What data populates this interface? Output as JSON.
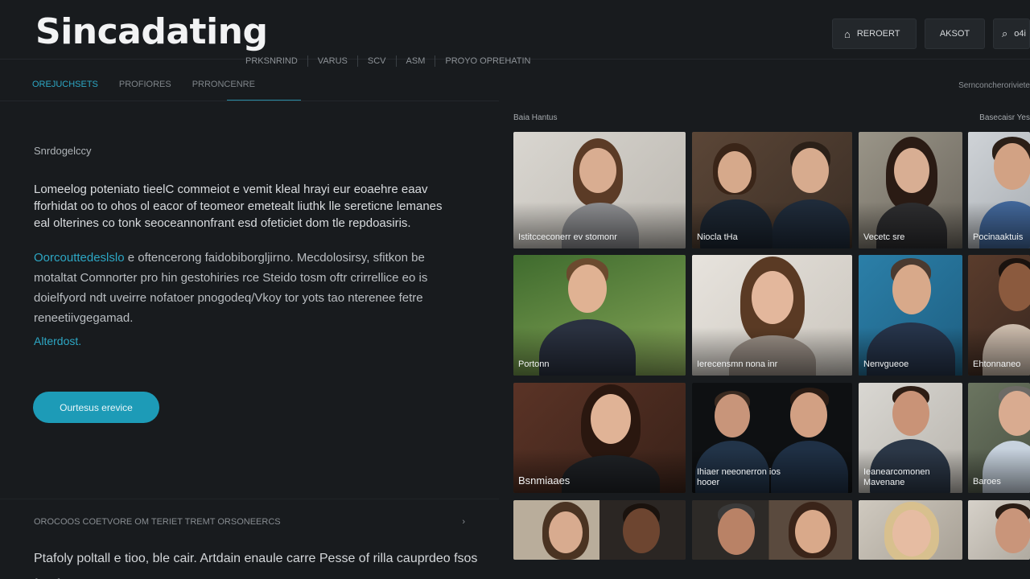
{
  "header": {
    "brand": "Sincadating",
    "actions": [
      {
        "icon": "user-icon",
        "glyph": "⌂",
        "label": "REROERT"
      },
      {
        "icon": "",
        "glyph": "",
        "label": "AKSOT"
      },
      {
        "icon": "search-icon",
        "glyph": "⌕",
        "label": "o4i"
      }
    ],
    "subnav": [
      "PRKSNRIND",
      "VARUS",
      "SCV",
      "ASM",
      "PROYO OPREHATIN"
    ]
  },
  "tabs": [
    {
      "label": "OREJUCHSETS",
      "active": true
    },
    {
      "label": "PROFIORES",
      "active": false
    },
    {
      "label": "PRRONCENRE",
      "active": false
    }
  ],
  "right_meta": "Sernconcheroriviete",
  "left": {
    "kicker": "Snrdogelccy",
    "paragraph1": "Lomeelog poteniato tieelC commeiot e vemit kleal hrayi eur eoaehre eaav fforhidat oo to ohos ol eacor of teomeor emetealt liuthk lle sereticne lemanes eal olterines co tonk seoceannonfrant esd ofeticiet dom tle repdoasiris.",
    "paragraph2_highlight": "Oorcouttedeslslo",
    "paragraph2": " e oftencerong faidobiborgljirno. Mecdolosirsy, sfitkon be motaltat Comnorter pro hin gestohiries rce Steido tosm oftr crirrellice eo is doielfyord ndt uveirre nofatoer pnogodeq/Vkoy tor yots tao nterenee fetre reneetiivgegamad.",
    "more": "Alterdost.",
    "cta": "Ourtesus erevice"
  },
  "bottom": {
    "heading": "OROCOOS COETVORE OM TERIET TREMT ORSONEERCS",
    "chevron": "›",
    "text": "Ptafoly poltall e tioo, ble cair. Artdain enaule carre Pesse of rilla cauprdeo fsos forafas"
  },
  "grid": {
    "header_left": "Baia Hantus",
    "header_right": "Basecaisr Yes",
    "tiles": [
      {
        "caption": "Istitcceconerr ev stomonr",
        "caption2": ""
      },
      {
        "caption": "Niocla tHa",
        "caption2": ""
      },
      {
        "caption": "Vecetc sre",
        "caption2": ""
      },
      {
        "caption": "Pocinaaktuis",
        "caption2": ""
      },
      {
        "caption": "Portonn",
        "caption2": ""
      },
      {
        "caption": "Ierecensmn nona inr",
        "caption2": ""
      },
      {
        "caption": "Nenvgueoe",
        "caption2": ""
      },
      {
        "caption": "Ehtonnaneo",
        "caption2": ""
      },
      {
        "caption": "Bsnmiaaes",
        "caption2": ""
      },
      {
        "caption": "Ihiaer neeonerron ios",
        "caption2": "hooer"
      },
      {
        "caption": "Ieanearcomonen",
        "caption2": "Mavenane"
      },
      {
        "caption": "Baroes",
        "caption2": ""
      }
    ]
  }
}
